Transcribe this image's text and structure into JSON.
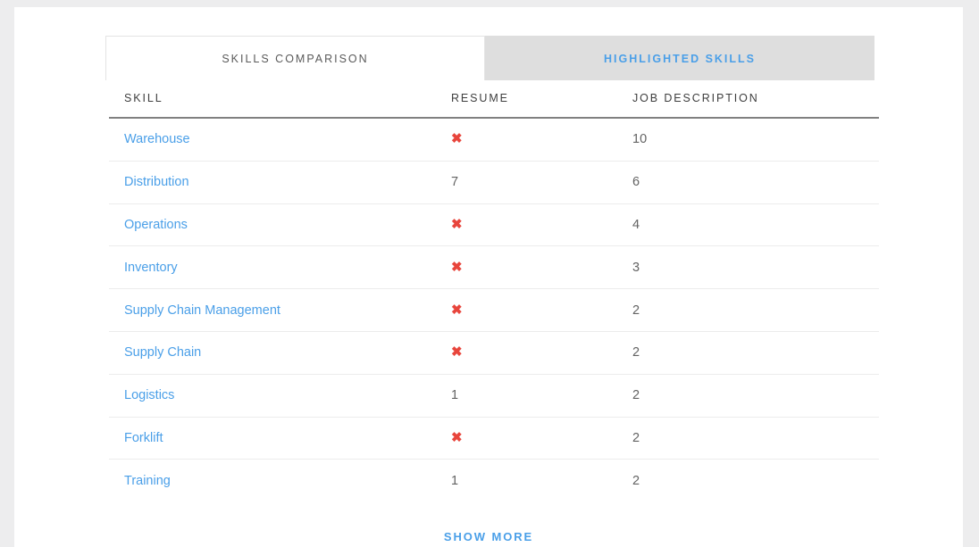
{
  "tabs": [
    {
      "label": "SKILLS COMPARISON",
      "active": true
    },
    {
      "label": "HIGHLIGHTED SKILLS",
      "active": false
    }
  ],
  "table": {
    "columns": {
      "skill": "SKILL",
      "resume": "RESUME",
      "job_description": "JOB DESCRIPTION"
    },
    "rows": [
      {
        "skill": "Warehouse",
        "resume": "✖",
        "resume_missing": true,
        "job_description": "10"
      },
      {
        "skill": "Distribution",
        "resume": "7",
        "resume_missing": false,
        "job_description": "6"
      },
      {
        "skill": "Operations",
        "resume": "✖",
        "resume_missing": true,
        "job_description": "4"
      },
      {
        "skill": "Inventory",
        "resume": "✖",
        "resume_missing": true,
        "job_description": "3"
      },
      {
        "skill": "Supply Chain Management",
        "resume": "✖",
        "resume_missing": true,
        "job_description": "2"
      },
      {
        "skill": "Supply Chain",
        "resume": "✖",
        "resume_missing": true,
        "job_description": "2"
      },
      {
        "skill": "Logistics",
        "resume": "1",
        "resume_missing": false,
        "job_description": "2"
      },
      {
        "skill": "Forklift",
        "resume": "✖",
        "resume_missing": true,
        "job_description": "2"
      },
      {
        "skill": "Training",
        "resume": "1",
        "resume_missing": false,
        "job_description": "2"
      }
    ]
  },
  "footer": {
    "show_more_label": "SHOW MORE"
  },
  "colors": {
    "link_blue": "#4a9fe8",
    "missing_red": "#e8453c",
    "tab_inactive_bg": "#dedede",
    "page_bg": "#ededee",
    "card_bg": "#ffffff",
    "header_rule": "#808080",
    "row_divider": "#ececec"
  }
}
